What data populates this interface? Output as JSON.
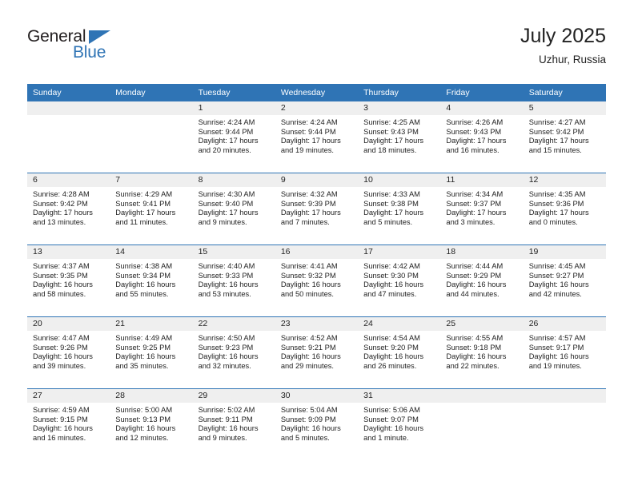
{
  "brand": {
    "name_top": "General",
    "name_bottom": "Blue",
    "accent_color": "#2f74b5",
    "text_color": "#231f20"
  },
  "header": {
    "title": "July 2025",
    "subtitle": "Uzhur, Russia"
  },
  "calendar": {
    "weekday_headers": [
      "Sunday",
      "Monday",
      "Tuesday",
      "Wednesday",
      "Thursday",
      "Friday",
      "Saturday"
    ],
    "header_bg": "#2f74b5",
    "header_text": "#ffffff",
    "daynum_band_bg": "#efefef",
    "weeks": [
      [
        {
          "day": "",
          "sunrise": "",
          "sunset": "",
          "daylight_line1": "",
          "daylight_line2": ""
        },
        {
          "day": "",
          "sunrise": "",
          "sunset": "",
          "daylight_line1": "",
          "daylight_line2": ""
        },
        {
          "day": "1",
          "sunrise": "Sunrise: 4:24 AM",
          "sunset": "Sunset: 9:44 PM",
          "daylight_line1": "Daylight: 17 hours",
          "daylight_line2": "and 20 minutes."
        },
        {
          "day": "2",
          "sunrise": "Sunrise: 4:24 AM",
          "sunset": "Sunset: 9:44 PM",
          "daylight_line1": "Daylight: 17 hours",
          "daylight_line2": "and 19 minutes."
        },
        {
          "day": "3",
          "sunrise": "Sunrise: 4:25 AM",
          "sunset": "Sunset: 9:43 PM",
          "daylight_line1": "Daylight: 17 hours",
          "daylight_line2": "and 18 minutes."
        },
        {
          "day": "4",
          "sunrise": "Sunrise: 4:26 AM",
          "sunset": "Sunset: 9:43 PM",
          "daylight_line1": "Daylight: 17 hours",
          "daylight_line2": "and 16 minutes."
        },
        {
          "day": "5",
          "sunrise": "Sunrise: 4:27 AM",
          "sunset": "Sunset: 9:42 PM",
          "daylight_line1": "Daylight: 17 hours",
          "daylight_line2": "and 15 minutes."
        }
      ],
      [
        {
          "day": "6",
          "sunrise": "Sunrise: 4:28 AM",
          "sunset": "Sunset: 9:42 PM",
          "daylight_line1": "Daylight: 17 hours",
          "daylight_line2": "and 13 minutes."
        },
        {
          "day": "7",
          "sunrise": "Sunrise: 4:29 AM",
          "sunset": "Sunset: 9:41 PM",
          "daylight_line1": "Daylight: 17 hours",
          "daylight_line2": "and 11 minutes."
        },
        {
          "day": "8",
          "sunrise": "Sunrise: 4:30 AM",
          "sunset": "Sunset: 9:40 PM",
          "daylight_line1": "Daylight: 17 hours",
          "daylight_line2": "and 9 minutes."
        },
        {
          "day": "9",
          "sunrise": "Sunrise: 4:32 AM",
          "sunset": "Sunset: 9:39 PM",
          "daylight_line1": "Daylight: 17 hours",
          "daylight_line2": "and 7 minutes."
        },
        {
          "day": "10",
          "sunrise": "Sunrise: 4:33 AM",
          "sunset": "Sunset: 9:38 PM",
          "daylight_line1": "Daylight: 17 hours",
          "daylight_line2": "and 5 minutes."
        },
        {
          "day": "11",
          "sunrise": "Sunrise: 4:34 AM",
          "sunset": "Sunset: 9:37 PM",
          "daylight_line1": "Daylight: 17 hours",
          "daylight_line2": "and 3 minutes."
        },
        {
          "day": "12",
          "sunrise": "Sunrise: 4:35 AM",
          "sunset": "Sunset: 9:36 PM",
          "daylight_line1": "Daylight: 17 hours",
          "daylight_line2": "and 0 minutes."
        }
      ],
      [
        {
          "day": "13",
          "sunrise": "Sunrise: 4:37 AM",
          "sunset": "Sunset: 9:35 PM",
          "daylight_line1": "Daylight: 16 hours",
          "daylight_line2": "and 58 minutes."
        },
        {
          "day": "14",
          "sunrise": "Sunrise: 4:38 AM",
          "sunset": "Sunset: 9:34 PM",
          "daylight_line1": "Daylight: 16 hours",
          "daylight_line2": "and 55 minutes."
        },
        {
          "day": "15",
          "sunrise": "Sunrise: 4:40 AM",
          "sunset": "Sunset: 9:33 PM",
          "daylight_line1": "Daylight: 16 hours",
          "daylight_line2": "and 53 minutes."
        },
        {
          "day": "16",
          "sunrise": "Sunrise: 4:41 AM",
          "sunset": "Sunset: 9:32 PM",
          "daylight_line1": "Daylight: 16 hours",
          "daylight_line2": "and 50 minutes."
        },
        {
          "day": "17",
          "sunrise": "Sunrise: 4:42 AM",
          "sunset": "Sunset: 9:30 PM",
          "daylight_line1": "Daylight: 16 hours",
          "daylight_line2": "and 47 minutes."
        },
        {
          "day": "18",
          "sunrise": "Sunrise: 4:44 AM",
          "sunset": "Sunset: 9:29 PM",
          "daylight_line1": "Daylight: 16 hours",
          "daylight_line2": "and 44 minutes."
        },
        {
          "day": "19",
          "sunrise": "Sunrise: 4:45 AM",
          "sunset": "Sunset: 9:27 PM",
          "daylight_line1": "Daylight: 16 hours",
          "daylight_line2": "and 42 minutes."
        }
      ],
      [
        {
          "day": "20",
          "sunrise": "Sunrise: 4:47 AM",
          "sunset": "Sunset: 9:26 PM",
          "daylight_line1": "Daylight: 16 hours",
          "daylight_line2": "and 39 minutes."
        },
        {
          "day": "21",
          "sunrise": "Sunrise: 4:49 AM",
          "sunset": "Sunset: 9:25 PM",
          "daylight_line1": "Daylight: 16 hours",
          "daylight_line2": "and 35 minutes."
        },
        {
          "day": "22",
          "sunrise": "Sunrise: 4:50 AM",
          "sunset": "Sunset: 9:23 PM",
          "daylight_line1": "Daylight: 16 hours",
          "daylight_line2": "and 32 minutes."
        },
        {
          "day": "23",
          "sunrise": "Sunrise: 4:52 AM",
          "sunset": "Sunset: 9:21 PM",
          "daylight_line1": "Daylight: 16 hours",
          "daylight_line2": "and 29 minutes."
        },
        {
          "day": "24",
          "sunrise": "Sunrise: 4:54 AM",
          "sunset": "Sunset: 9:20 PM",
          "daylight_line1": "Daylight: 16 hours",
          "daylight_line2": "and 26 minutes."
        },
        {
          "day": "25",
          "sunrise": "Sunrise: 4:55 AM",
          "sunset": "Sunset: 9:18 PM",
          "daylight_line1": "Daylight: 16 hours",
          "daylight_line2": "and 22 minutes."
        },
        {
          "day": "26",
          "sunrise": "Sunrise: 4:57 AM",
          "sunset": "Sunset: 9:17 PM",
          "daylight_line1": "Daylight: 16 hours",
          "daylight_line2": "and 19 minutes."
        }
      ],
      [
        {
          "day": "27",
          "sunrise": "Sunrise: 4:59 AM",
          "sunset": "Sunset: 9:15 PM",
          "daylight_line1": "Daylight: 16 hours",
          "daylight_line2": "and 16 minutes."
        },
        {
          "day": "28",
          "sunrise": "Sunrise: 5:00 AM",
          "sunset": "Sunset: 9:13 PM",
          "daylight_line1": "Daylight: 16 hours",
          "daylight_line2": "and 12 minutes."
        },
        {
          "day": "29",
          "sunrise": "Sunrise: 5:02 AM",
          "sunset": "Sunset: 9:11 PM",
          "daylight_line1": "Daylight: 16 hours",
          "daylight_line2": "and 9 minutes."
        },
        {
          "day": "30",
          "sunrise": "Sunrise: 5:04 AM",
          "sunset": "Sunset: 9:09 PM",
          "daylight_line1": "Daylight: 16 hours",
          "daylight_line2": "and 5 minutes."
        },
        {
          "day": "31",
          "sunrise": "Sunrise: 5:06 AM",
          "sunset": "Sunset: 9:07 PM",
          "daylight_line1": "Daylight: 16 hours",
          "daylight_line2": "and 1 minute."
        },
        {
          "day": "",
          "sunrise": "",
          "sunset": "",
          "daylight_line1": "",
          "daylight_line2": ""
        },
        {
          "day": "",
          "sunrise": "",
          "sunset": "",
          "daylight_line1": "",
          "daylight_line2": ""
        }
      ]
    ]
  }
}
